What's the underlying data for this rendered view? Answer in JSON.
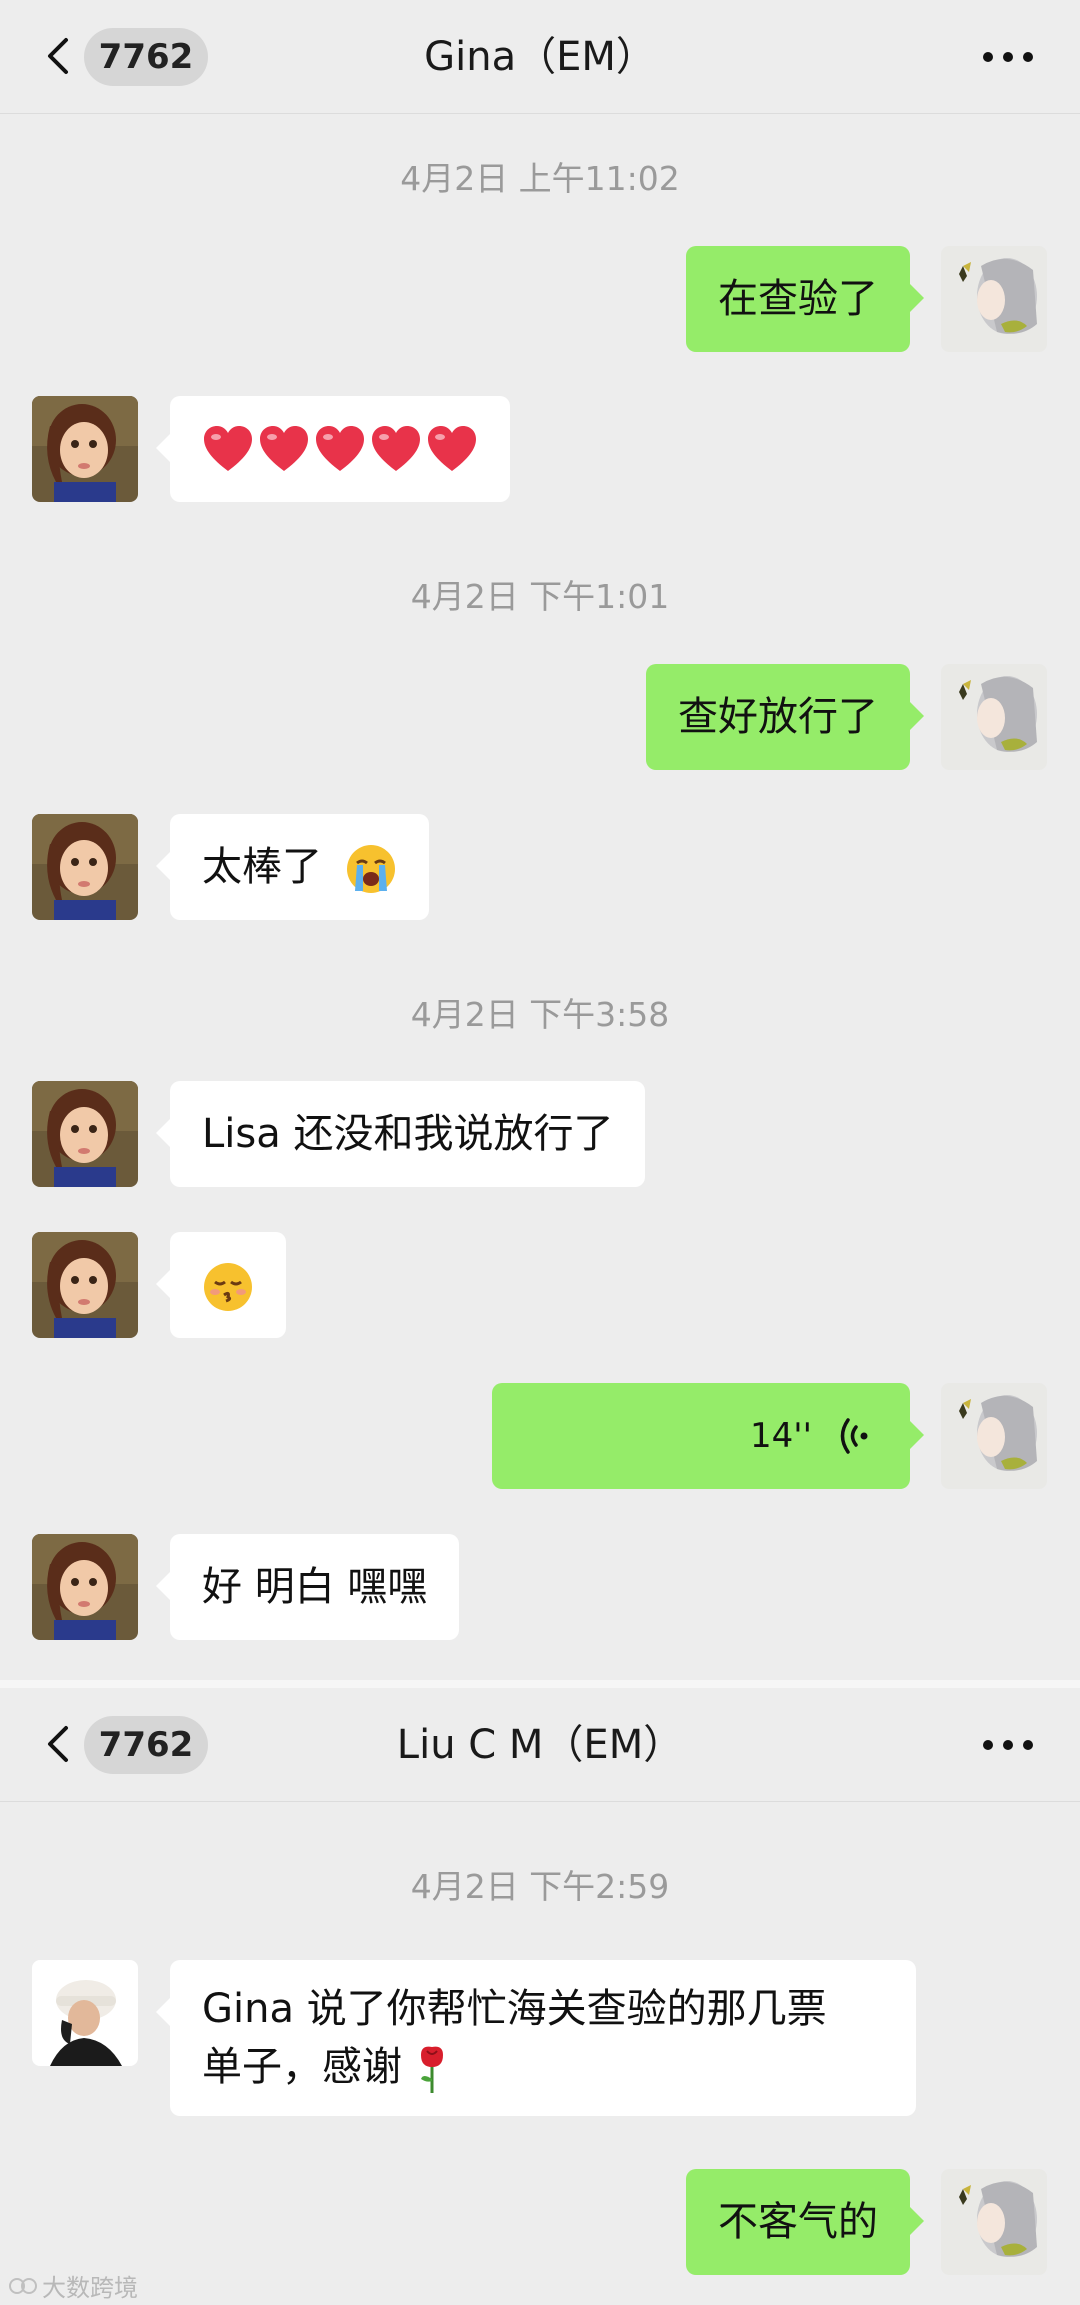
{
  "chat1": {
    "back_count": "7762",
    "title": "Gina（EM）",
    "timestamps": [
      "4月2日 上午11:02",
      "4月2日 下午1:01",
      "4月2日 下午3:58"
    ],
    "messages": [
      {
        "text": "在查验了"
      },
      {
        "emoji": "red-heart x5"
      },
      {
        "text": "查好放行了"
      },
      {
        "text": "太棒了",
        "emoji": "loudly-crying-face"
      },
      {
        "text": "Lisa 还没和我说放行了"
      },
      {
        "emoji": "kissing-face-closed-eyes"
      },
      {
        "voice_duration": "14''"
      },
      {
        "text": "好 明白 嘿嘿"
      }
    ]
  },
  "chat2": {
    "back_count": "7762",
    "title": "Liu C M（EM）",
    "timestamps": [
      "4月2日 下午2:59"
    ],
    "messages": [
      {
        "text_line1": "Gina 说了你帮忙海关查验的那几票",
        "text_line2": "单子，感谢",
        "emoji": "rose"
      },
      {
        "text": "不客气的"
      }
    ]
  },
  "colors": {
    "outgoing_bubble": "#95ec69",
    "incoming_bubble": "#ffffff",
    "background": "#ededed"
  },
  "watermark": "大数跨境"
}
